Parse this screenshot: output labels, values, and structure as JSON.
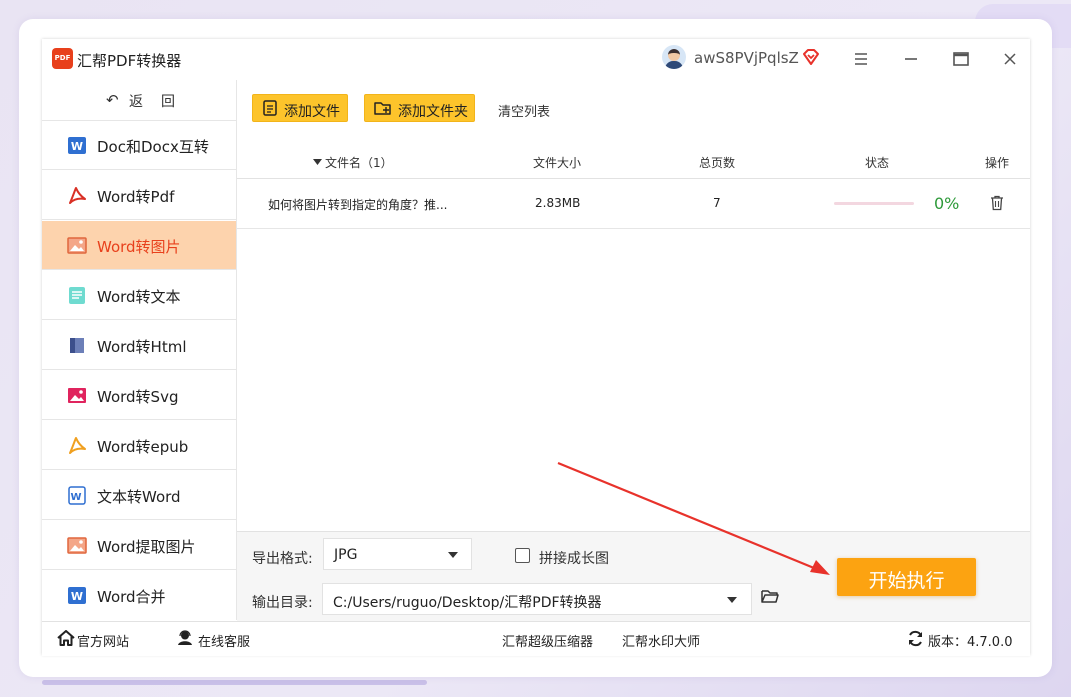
{
  "app": {
    "title": "汇帮PDF转换器",
    "logo_text": "PDF",
    "username": "awS8PVjPqlsZ"
  },
  "sidebar": {
    "back_icon": "↶",
    "back_label": "返回",
    "items": [
      {
        "label": "Doc和Docx互转",
        "icon": "word-doc-icon"
      },
      {
        "label": "Word转Pdf",
        "icon": "acrobat-icon"
      },
      {
        "label": "Word转图片",
        "icon": "image-icon",
        "active": true
      },
      {
        "label": "Word转文本",
        "icon": "text-file-icon"
      },
      {
        "label": "Word转Html",
        "icon": "html-book-icon"
      },
      {
        "label": "Word转Svg",
        "icon": "svg-image-icon"
      },
      {
        "label": "Word转epub",
        "icon": "epub-icon"
      },
      {
        "label": "文本转Word",
        "icon": "word-outline-icon"
      },
      {
        "label": "Word提取图片",
        "icon": "extract-image-icon"
      },
      {
        "label": "Word合并",
        "icon": "word-merge-icon"
      }
    ]
  },
  "toolbar": {
    "add_file": "添加文件",
    "add_folder": "添加文件夹",
    "clear_list": "清空列表"
  },
  "table": {
    "headers": {
      "name": "文件名（1）",
      "size": "文件大小",
      "pages": "总页数",
      "status": "状态",
      "action": "操作"
    },
    "rows": [
      {
        "name": "如何将图片转到指定的角度？推...",
        "size": "2.83MB",
        "pages": "7",
        "progress": 0,
        "progress_text": "0%"
      }
    ]
  },
  "settings": {
    "format_label": "导出格式:",
    "format_value": "JPG",
    "stitch_label": "拼接成长图",
    "stitch_checked": false,
    "output_label": "输出目录:",
    "output_value": "C:/Users/ruguo/Desktop/汇帮PDF转换器",
    "start_label": "开始执行"
  },
  "statusbar": {
    "website": "官方网站",
    "support": "在线客服",
    "compressor": "汇帮超级压缩器",
    "watermark": "汇帮水印大师",
    "version": "版本：4.7.0.0"
  },
  "colors": {
    "accent_orange": "#fca311",
    "toolbar_yellow": "#fdc42b",
    "active_bg": "#fdd3ad",
    "active_text": "#e8401c",
    "progress_green": "#2e9a3a",
    "arrow_red": "#e8322b"
  }
}
